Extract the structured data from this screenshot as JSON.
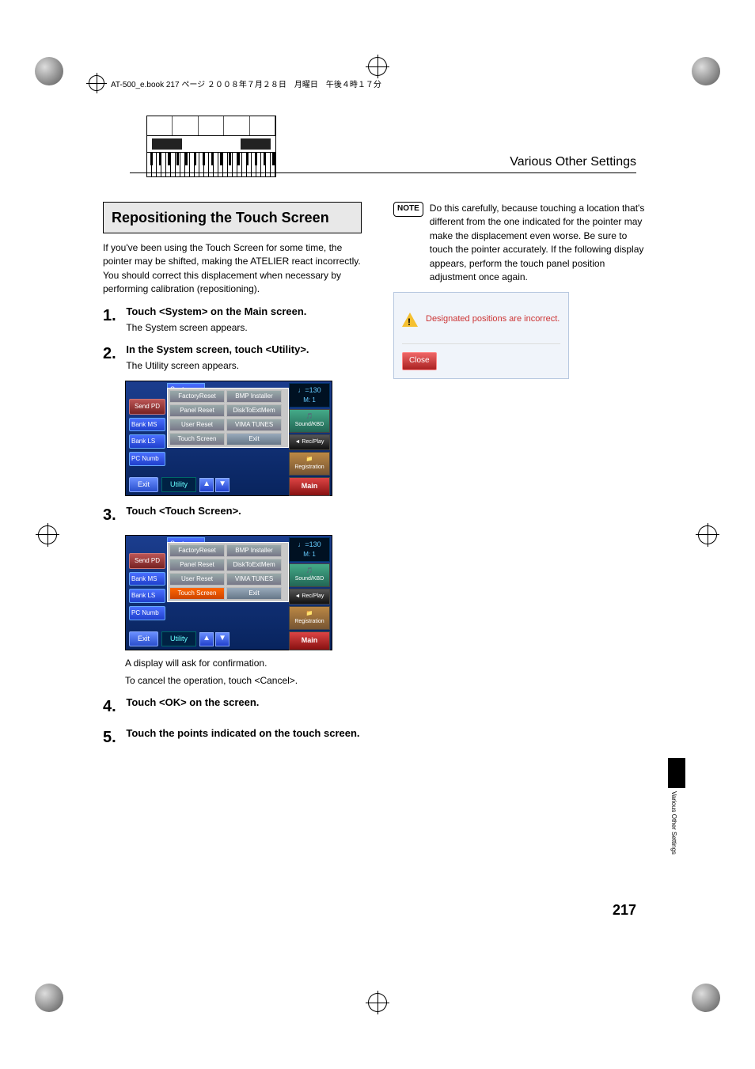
{
  "header_text": "AT-500_e.book  217 ページ  ２００８年７月２８日　月曜日　午後４時１７分",
  "section_title": "Various Other Settings",
  "side_text": "Various Other Settings",
  "page_number": "217",
  "boxed_heading": "Repositioning the Touch Screen",
  "intro": "If you've been using the Touch Screen for some time, the pointer may be shifted, making the ATELIER react incorrectly. You should correct this displacement when necessary by performing calibration (repositioning).",
  "steps": [
    {
      "num": "1.",
      "title": "Touch <System> on the Main screen.",
      "sub": "The System screen appears."
    },
    {
      "num": "2.",
      "title": "In the System screen, touch <Utility>.",
      "sub": "The Utility screen appears."
    },
    {
      "num": "3.",
      "title": "Touch <Touch Screen>.",
      "sub": ""
    },
    {
      "num": "4.",
      "title": "Touch <OK> on the screen.",
      "sub": ""
    },
    {
      "num": "5.",
      "title": "Touch the points indicated on the touch screen.",
      "sub": ""
    }
  ],
  "post_screenshot_text_a": "A display will ask for confirmation.",
  "post_screenshot_text_b": "To cancel the operation, touch <Cancel>.",
  "note_label": "NOTE",
  "note_text": "Do this carefully, because touching a location that's different from the one indicated for the pointer may make the displacement even worse. Be sure to touch the pointer accurately. If the following display appears, perform the touch panel position adjustment once again.",
  "dialog": {
    "message": "Designated positions are incorrect.",
    "close": "Close"
  },
  "ui": {
    "system_tab": "Syste",
    "sidebar": [
      "Send PD",
      "Bank MS",
      "Bank LS",
      "PC Numb"
    ],
    "popup_cells": [
      "FactoryReset",
      "BMP Installer",
      "Panel Reset",
      "DiskToExtMem",
      "User Reset",
      "VIMA TUNES",
      "Touch Screen"
    ],
    "popup_exit": "Exit",
    "tempo_value": "♩=130",
    "tempo_m": "M:    1",
    "right_tabs": {
      "sound": "🎵 Sound/KBD",
      "rec": "◄ Rec/Play",
      "reg": "📁 Registration",
      "main": "Main"
    },
    "bottom_exit": "Exit",
    "bottom_utility": "Utility"
  }
}
